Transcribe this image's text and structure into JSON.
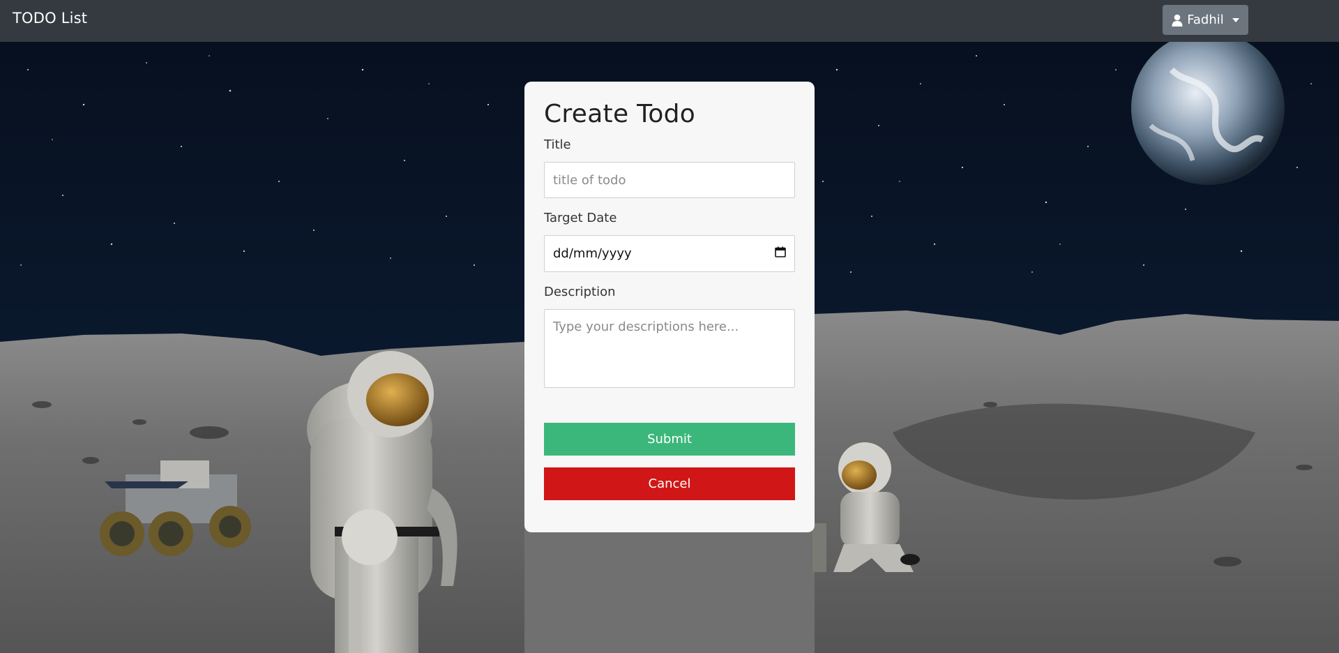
{
  "navbar": {
    "brand": "TODO List",
    "user_label": "Fadhil"
  },
  "form": {
    "heading": "Create Todo",
    "title_label": "Title",
    "title_placeholder": "title of todo",
    "date_label": "Target Date",
    "date_placeholder": "dd/mm/yyyy",
    "description_label": "Description",
    "description_placeholder": "Type your descriptions here...",
    "submit_label": "Submit",
    "cancel_label": "Cancel"
  },
  "colors": {
    "navbar_bg": "#343a40",
    "user_button_bg": "#6c757d",
    "submit_bg": "#3cb77b",
    "cancel_bg": "#d01616",
    "card_bg": "#f7f7f7"
  },
  "icons": {
    "user": "user-icon",
    "dropdown": "caret-down-icon",
    "calendar": "calendar-icon"
  }
}
